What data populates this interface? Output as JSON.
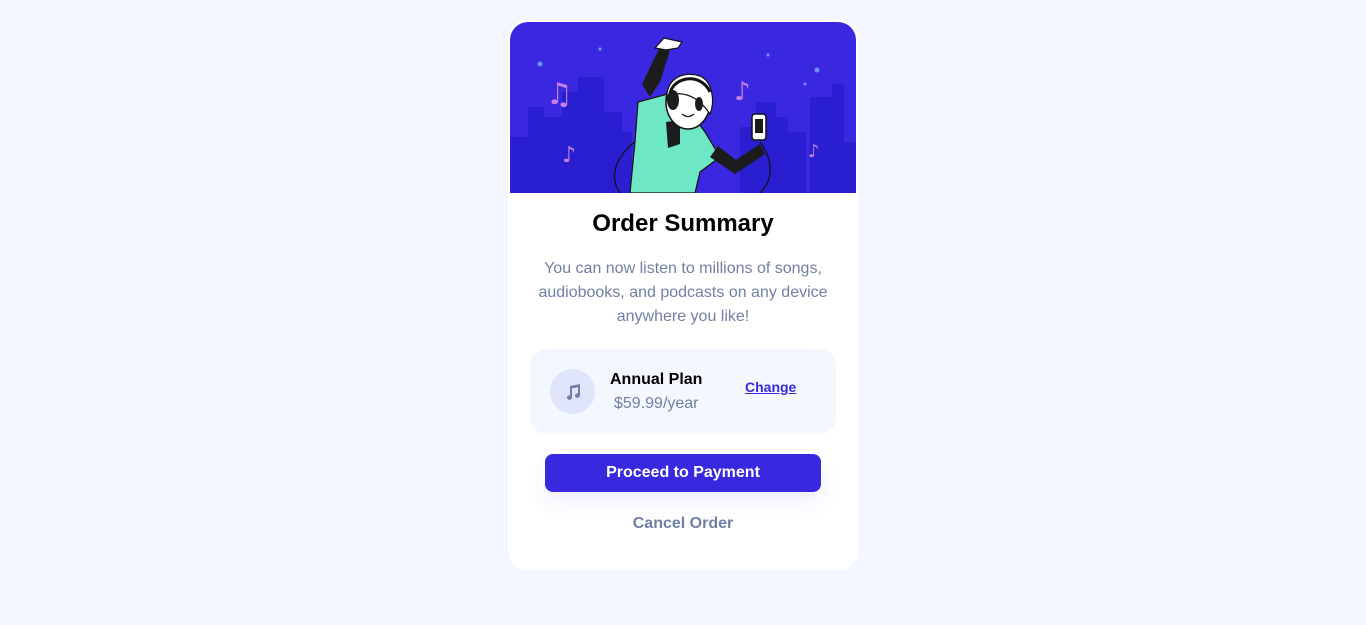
{
  "card": {
    "title": "Order Summary",
    "description": "You can now listen to millions of songs, audiobooks, and podcasts on any device anywhere you like!"
  },
  "plan": {
    "name": "Annual Plan",
    "price": "$59.99/year",
    "change_label": "Change",
    "icon": "music-note-icon"
  },
  "actions": {
    "proceed_label": "Proceed to Payment",
    "cancel_label": "Cancel Order"
  },
  "colors": {
    "background": "#f4f7ff",
    "hero": "#3829e0",
    "accent": "#3829e0",
    "muted_text": "#717fa6",
    "plan_bg": "#f5f7ff"
  }
}
